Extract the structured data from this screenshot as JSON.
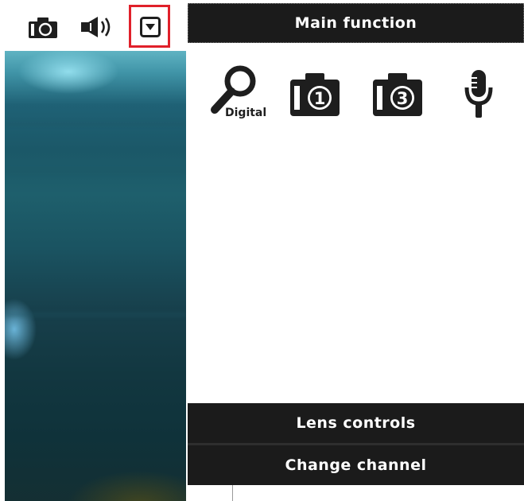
{
  "toolbar": {
    "snapshot_icon": "camera-icon",
    "audio_icon": "speaker-icon",
    "dropdown_icon": "dropdown-arrow-icon",
    "highlight_color": "#e0202a"
  },
  "main_function": {
    "title": "Main function",
    "buttons": [
      {
        "icon": "digital-zoom-icon",
        "label": "Digital"
      },
      {
        "icon": "snapshot-1-icon",
        "number": "1"
      },
      {
        "icon": "snapshot-3-icon",
        "number": "3"
      },
      {
        "icon": "microphone-icon"
      }
    ]
  },
  "lens_controls": {
    "label": "Lens controls"
  },
  "change_channel": {
    "label": "Change channel"
  },
  "colors": {
    "bar_background": "#1b1b1b",
    "bar_text": "#ffffff",
    "icon_color": "#1e1e1e"
  }
}
